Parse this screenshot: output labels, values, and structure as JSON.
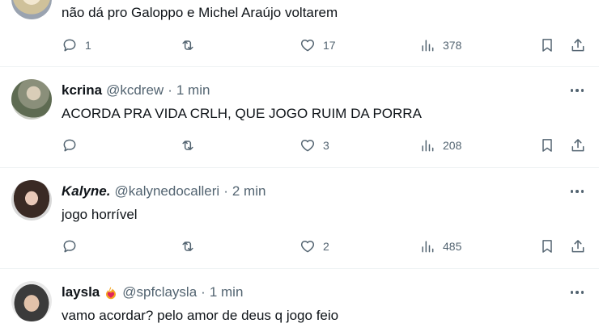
{
  "posts": [
    {
      "name": "",
      "handle": "",
      "time": "",
      "text": "não dá pro Galoppo e Michel Araújo voltarem",
      "replies": "1",
      "reposts": "",
      "likes": "17",
      "views": "378"
    },
    {
      "name": "kcrina",
      "handle": "@kcdrew",
      "time": "1 min",
      "text": "ACORDA PRA VIDA CRLH, QUE JOGO RUIM DA PORRA",
      "replies": "",
      "reposts": "",
      "likes": "3",
      "views": "208"
    },
    {
      "name": "Kalyne.",
      "handle": "@kalynedocalleri",
      "time": "2 min",
      "text": "jogo horrível",
      "replies": "",
      "reposts": "",
      "likes": "2",
      "views": "485"
    },
    {
      "name": "laysla",
      "handle": "@spfclaysla",
      "time": "1 min",
      "text": "vamo acordar? pelo amor de deus q jogo feio",
      "replies": "",
      "reposts": "",
      "likes": "",
      "views": ""
    }
  ],
  "separator": "·",
  "colors": {
    "text": "#0f1419",
    "secondary": "#536471",
    "border": "#eff3f4",
    "badge": "#e0245e"
  },
  "icons": [
    "reply-icon",
    "repost-icon",
    "like-icon",
    "views-icon",
    "bookmark-icon",
    "share-icon",
    "more-icon",
    "heart-fire-emoji-icon"
  ]
}
